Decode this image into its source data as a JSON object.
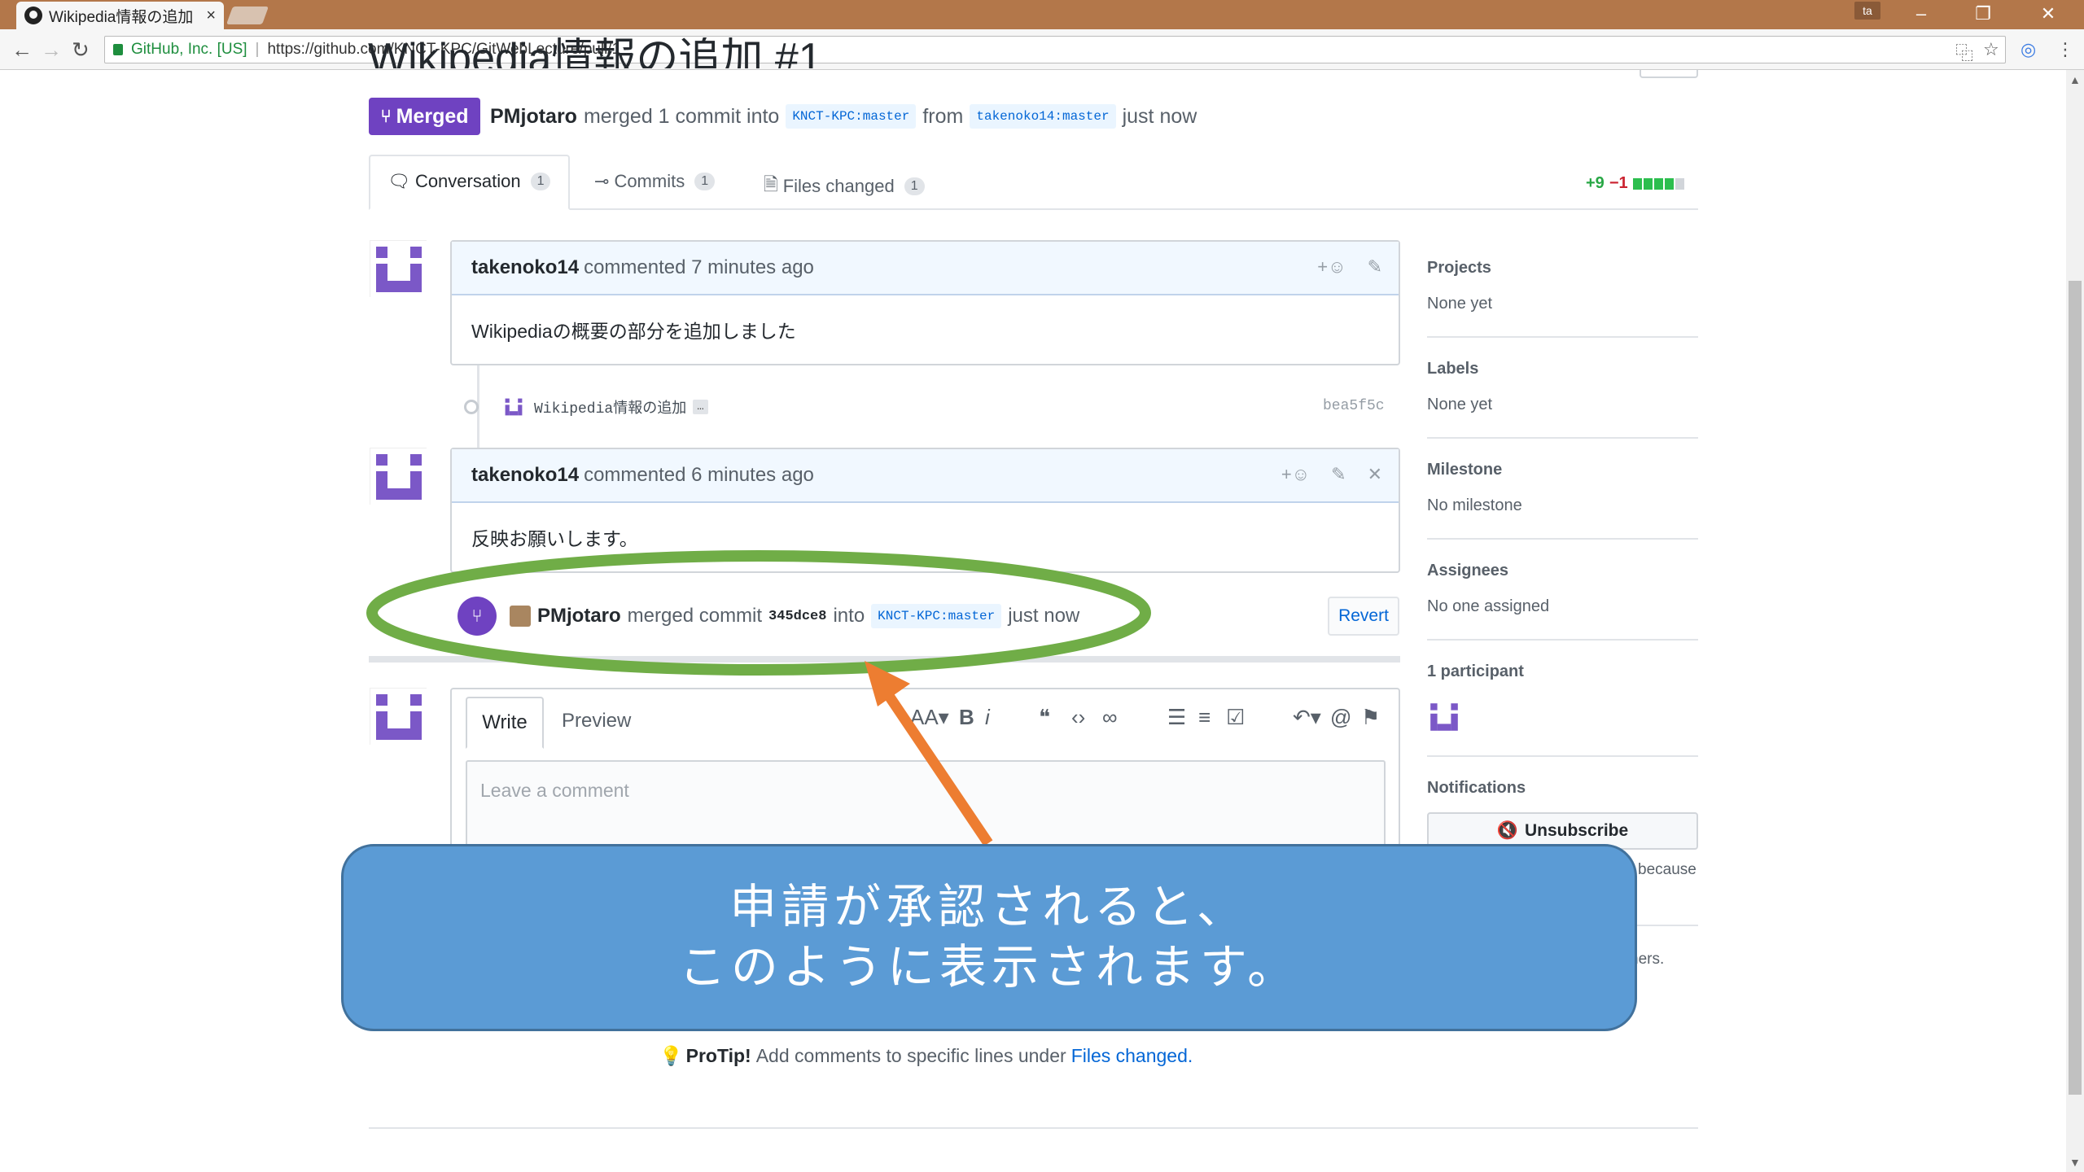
{
  "browser": {
    "tab_title": "Wikipedia情報の追加",
    "tab_close": "×",
    "profile": "ta",
    "window_controls": [
      "–",
      "❐",
      "✕"
    ],
    "secure_label": "GitHub, Inc. [US]",
    "url": "https://github.com/KNCT-KPC/GitWebLecture/pull/1"
  },
  "pr": {
    "title": "Wikipedia情報の追加 #1",
    "state": "Merged",
    "merged_by": "PMjotaro",
    "merge_text_1": "merged 1 commit into",
    "base_branch": "KNCT-KPC:master",
    "merge_text_2": "from",
    "head_branch": "takenoko14:master",
    "merge_time": "just now"
  },
  "tabs": [
    {
      "label": "Conversation",
      "count": "1"
    },
    {
      "label": "Commits",
      "count": "1"
    },
    {
      "label": "Files changed",
      "count": "1"
    }
  ],
  "diffstat": {
    "additions": "+9",
    "deletions": "−1"
  },
  "comments": [
    {
      "author": "takenoko14",
      "meta": "commented 7 minutes ago",
      "body": "Wikipediaの概要の部分を追加しました"
    },
    {
      "author": "takenoko14",
      "meta": "commented 6 minutes ago",
      "body": "反映お願いします。"
    }
  ],
  "commit": {
    "message": "Wikipedia情報の追加",
    "ellipsis": "…",
    "sha": "bea5f5c"
  },
  "merge_event": {
    "user": "PMjotaro",
    "text_1": "merged commit",
    "sha": "345dce8",
    "text_2": "into",
    "branch": "KNCT-KPC:master",
    "time": "just now",
    "revert_label": "Revert"
  },
  "editor": {
    "write_tab": "Write",
    "preview_tab": "Preview",
    "placeholder": "Leave a comment"
  },
  "protip": {
    "label": "ProTip!",
    "text": "Add comments to specific lines under",
    "link": "Files changed",
    "period": "."
  },
  "sidebar": {
    "projects_title": "Projects",
    "projects_value": "None yet",
    "labels_title": "Labels",
    "labels_value": "None yet",
    "milestone_title": "Milestone",
    "milestone_value": "No milestone",
    "assignees_title": "Assignees",
    "assignees_value": "No one assigned",
    "participants_title": "1 participant",
    "notifications_title": "Notifications",
    "unsubscribe_label": "Unsubscribe",
    "because_fragment": "because",
    "hers_fragment": "hers."
  },
  "annotation": {
    "line1": "申請が承認されると、",
    "line2": "このように表示されます。"
  },
  "colors": {
    "merged_purple": "#6f42c1",
    "link_blue": "#0366d6",
    "callout_fill": "#5b9bd5",
    "ellipse_green": "#70ad47",
    "arrow_orange": "#ed7d31"
  }
}
